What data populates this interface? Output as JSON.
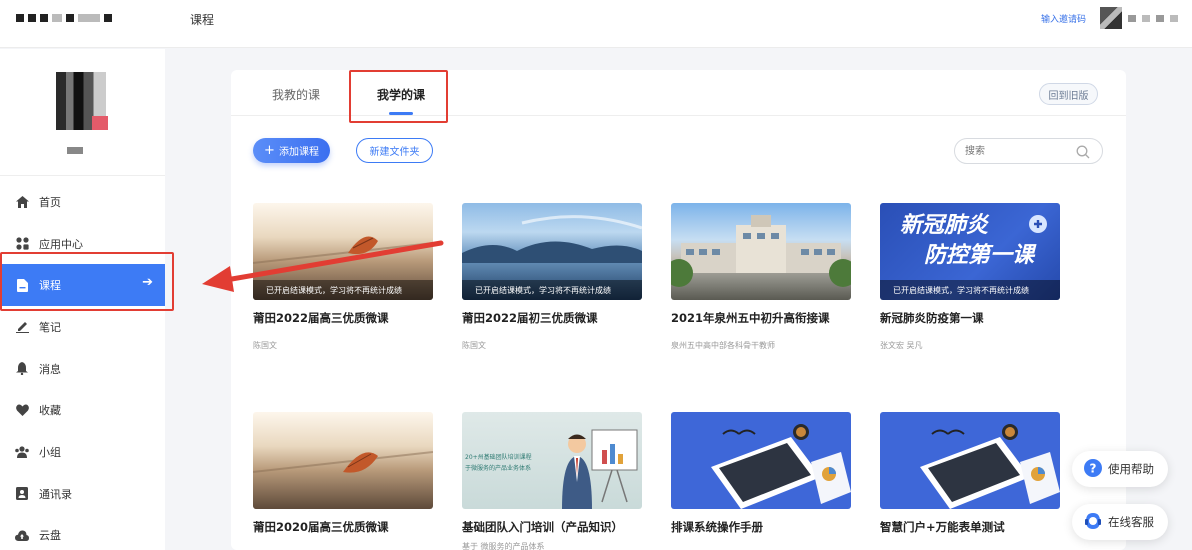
{
  "header": {
    "page_title": "课程",
    "invite_label": "输入邀请码"
  },
  "sidebar": {
    "items": [
      {
        "label": "首页",
        "icon": "home-icon"
      },
      {
        "label": "应用中心",
        "icon": "apps-icon"
      },
      {
        "label": "课程",
        "icon": "course-icon",
        "active": true
      },
      {
        "label": "笔记",
        "icon": "note-icon"
      },
      {
        "label": "消息",
        "icon": "bell-icon"
      },
      {
        "label": "收藏",
        "icon": "heart-icon"
      },
      {
        "label": "小组",
        "icon": "group-icon"
      },
      {
        "label": "通讯录",
        "icon": "contacts-icon"
      },
      {
        "label": "云盘",
        "icon": "cloud-icon"
      }
    ]
  },
  "main": {
    "tabs": [
      {
        "label": "我教的课"
      },
      {
        "label": "我学的课",
        "active": true
      }
    ],
    "old_version_label": "回到旧版",
    "add_course_label": "添加课程",
    "new_folder_label": "新建文件夹",
    "search_placeholder": "搜索",
    "courses": [
      {
        "title": "莆田2022届高三优质微课",
        "teacher": "陈国文",
        "note": "已开启结课模式，学习将不再统计成绩"
      },
      {
        "title": "莆田2022届初三优质微课",
        "teacher": "陈国文",
        "note": "已开启结课模式，学习将不再统计成绩"
      },
      {
        "title": "2021年泉州五中初升高衔接课",
        "teacher": "泉州五中高中部各科骨干教师",
        "note": ""
      },
      {
        "title": "新冠肺炎防疫第一课",
        "teacher": "张文宏 吴凡",
        "note": "已开启结课模式，学习将不再统计成绩",
        "cover_text_1": "新冠肺炎",
        "cover_text_2": "防控第一课"
      },
      {
        "title": "莆田2020届高三优质微课",
        "teacher": "",
        "note": ""
      },
      {
        "title": "基础团队入门培训（产品知识）",
        "teacher": "基于 微服务的产品体系",
        "note": "",
        "cover_text_1": "20+州基础团队培训课程",
        "cover_text_2": "于微服务的产品业务体系"
      },
      {
        "title": "排课系统操作手册",
        "teacher": "",
        "note": ""
      },
      {
        "title": "智慧门户+万能表单测试",
        "teacher": "",
        "note": ""
      }
    ]
  },
  "floating": {
    "help_label": "使用帮助",
    "service_label": "在线客服"
  },
  "colors": {
    "accent": "#3d7bf5",
    "annotation": "#e23d33"
  }
}
